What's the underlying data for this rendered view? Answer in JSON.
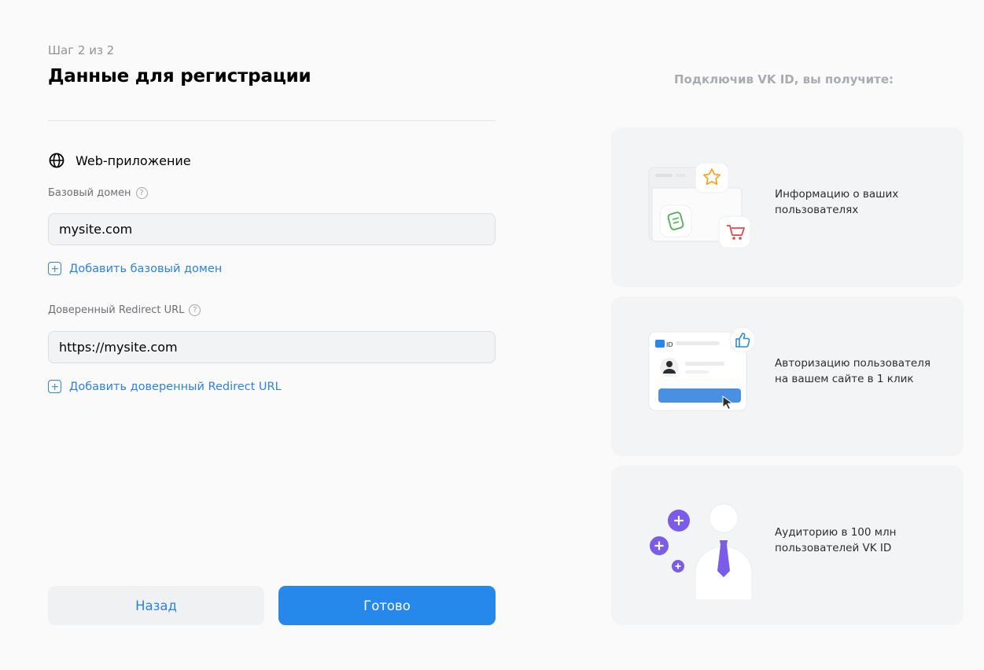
{
  "step": "Шаг 2 из 2",
  "title": "Данные для регистрации",
  "section": {
    "label": "Web-приложение",
    "icon": "globe-icon"
  },
  "base_domain": {
    "label": "Базовый домен",
    "help": "?",
    "value": "mysite.com",
    "add_label": "Добавить базовый домен"
  },
  "redirect": {
    "label": "Доверенный Redirect URL",
    "help": "?",
    "value": "https://mysite.com",
    "add_label": "Добавить доверенный Redirect URL"
  },
  "buttons": {
    "back": "Назад",
    "done": "Готово"
  },
  "benefits": {
    "title": "Подключив VK ID, вы получите:",
    "items": [
      {
        "text_1": "Информацию о ваших",
        "text_2": "пользователях",
        "icon": "folder-icon"
      },
      {
        "text_1": "Авторизацию пользователя",
        "text_2": "на вашем сайте в 1 клик",
        "icon": "login-card-icon"
      },
      {
        "text_1": "Аудиторию в 100 млн",
        "text_2": "пользователей VK ID",
        "icon": "person-icon"
      }
    ],
    "mini_logo": "ID"
  },
  "colors": {
    "accent": "#2688eb",
    "link": "#2d81e0",
    "purple": "#7b5ce8",
    "card_bg": "#f3f4f5"
  }
}
